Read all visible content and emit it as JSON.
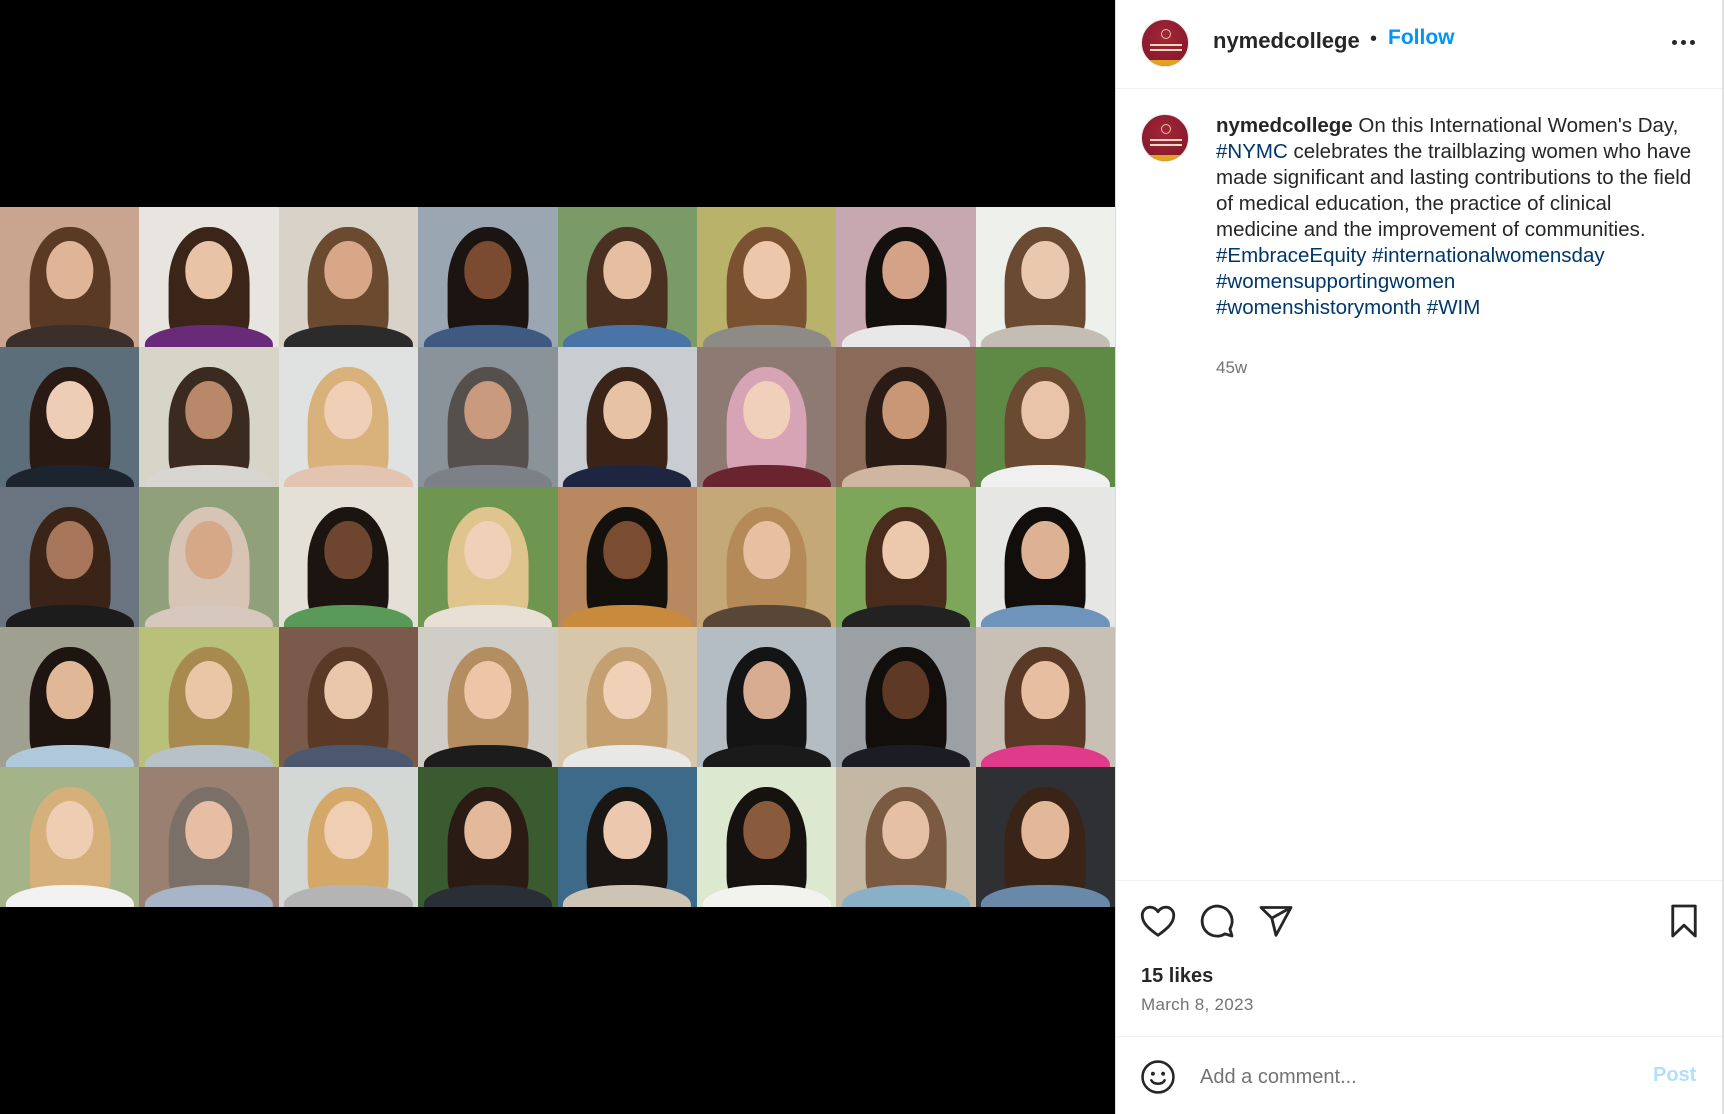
{
  "post": {
    "username": "nymedcollege",
    "separator": "•",
    "follow_label": "Follow",
    "caption": {
      "username": "nymedcollege",
      "text_1": "On this International Women's Day,",
      "tag_1": "#NYMC",
      "text_2": "celebrates the trailblazing women who have made significant and lasting contributions to the field of medical education, the practice of clinical medicine and the improvement of communities.",
      "hashtags": [
        "#EmbraceEquity",
        "#internationalwomensday",
        "#womensupportingwomen",
        "#womenshistorymonth",
        "#WIM"
      ]
    },
    "time_ago": "45w",
    "likes": "15 likes",
    "date": "March 8, 2023"
  },
  "comment": {
    "placeholder": "Add a comment...",
    "post_label": "Post"
  },
  "icons": {
    "more": "more-options-icon",
    "like": "heart-icon",
    "comment": "comment-bubble-icon",
    "share": "paper-plane-icon",
    "save": "bookmark-icon",
    "emoji": "emoji-icon"
  },
  "colors": {
    "link": "#0095f6",
    "hashtag": "#00376b",
    "brand_maroon": "#8a1a2c",
    "post_disabled": "#b2dffc"
  },
  "portrait_grid": {
    "columns": 8,
    "rows": 5,
    "tiles": [
      {
        "bg": "#c9a58f",
        "hair": "#5a3a24",
        "skin": "#e0b497",
        "shirt": "#3a2f2a"
      },
      {
        "bg": "#e8e4df",
        "hair": "#3b2418",
        "skin": "#e9c3a6",
        "shirt": "#6a2a7a"
      },
      {
        "bg": "#d9d2c9",
        "hair": "#6b4a30",
        "skin": "#d7a787",
        "shirt": "#2b2b2b"
      },
      {
        "bg": "#9aa6b1",
        "hair": "#1c1410",
        "skin": "#7a4b30",
        "shirt": "#3f5a80"
      },
      {
        "bg": "#7a9a68",
        "hair": "#4a3020",
        "skin": "#e6bfa3",
        "shirt": "#4a74a8"
      },
      {
        "bg": "#b9b26a",
        "hair": "#7a5232",
        "skin": "#ecc7ab",
        "shirt": "#8e8a85"
      },
      {
        "bg": "#c8a8b0",
        "hair": "#14100e",
        "skin": "#d3a287",
        "shirt": "#e8e8e8"
      },
      {
        "bg": "#eef0ec",
        "hair": "#6a4a30",
        "skin": "#e9c8ae",
        "shirt": "#c4bdb3"
      },
      {
        "bg": "#5b6e7a",
        "hair": "#2a1a14",
        "skin": "#edcdb6",
        "shirt": "#1c2430"
      },
      {
        "bg": "#d7d4c8",
        "hair": "#3a2a20",
        "skin": "#b9876a",
        "shirt": "#d8d6d0"
      },
      {
        "bg": "#dfe2e0",
        "hair": "#d8b27a",
        "skin": "#efcfb6",
        "shirt": "#e2c4b0"
      },
      {
        "bg": "#8a929a",
        "hair": "#55504c",
        "skin": "#c99a7e",
        "shirt": "#7e8088"
      },
      {
        "bg": "#c9ccd0",
        "hair": "#3a2418",
        "skin": "#e8c2a5",
        "shirt": "#1e2540"
      },
      {
        "bg": "#8e7a72",
        "hair": "#d6a4b4",
        "skin": "#f0d0bb",
        "shirt": "#6a2430"
      },
      {
        "bg": "#8a6a58",
        "hair": "#2a1c14",
        "skin": "#c99676",
        "shirt": "#d0b6a0"
      },
      {
        "bg": "#5e8a46",
        "hair": "#6a4a30",
        "skin": "#e9c4a8",
        "shirt": "#f0f0f0"
      },
      {
        "bg": "#6a7480",
        "hair": "#3a2418",
        "skin": "#a8765a",
        "shirt": "#1c1c1c"
      },
      {
        "bg": "#8fa07a",
        "hair": "#d8c4b4",
        "skin": "#d6a888",
        "shirt": "#d6c8bc"
      },
      {
        "bg": "#e4e0d8",
        "hair": "#1c1410",
        "skin": "#6e4630",
        "shirt": "#5a9a58"
      },
      {
        "bg": "#6e9650",
        "hair": "#e0c48e",
        "skin": "#f0d0b8",
        "shirt": "#e8e0d4"
      },
      {
        "bg": "#b88860",
        "hair": "#14100c",
        "skin": "#7a4c32",
        "shirt": "#c88a3c"
      },
      {
        "bg": "#c4a878",
        "hair": "#b48a58",
        "skin": "#e6c0a0",
        "shirt": "#5a4636"
      },
      {
        "bg": "#7ea65a",
        "hair": "#4a2c1c",
        "skin": "#ecc8ac",
        "shirt": "#222222"
      },
      {
        "bg": "#e6e6e4",
        "hair": "#120e0c",
        "skin": "#ddb294",
        "shirt": "#6e94bc"
      },
      {
        "bg": "#a0a090",
        "hair": "#1e1410",
        "skin": "#e0b898",
        "shirt": "#b0c8dc"
      },
      {
        "bg": "#b8c07a",
        "hair": "#a88a4e",
        "skin": "#ebc6a6",
        "shirt": "#b8c0c8"
      },
      {
        "bg": "#7a5a4a",
        "hair": "#5a3a26",
        "skin": "#eac6aa",
        "shirt": "#4c5870"
      },
      {
        "bg": "#d0ccc6",
        "hair": "#b48e60",
        "skin": "#ecc6a6",
        "shirt": "#1c1c1c"
      },
      {
        "bg": "#d8c6a8",
        "hair": "#c4a070",
        "skin": "#f0d0b6",
        "shirt": "#e8e8e6"
      },
      {
        "bg": "#b4bcc4",
        "hair": "#141414",
        "skin": "#d8ac90",
        "shirt": "#1a1a1a"
      },
      {
        "bg": "#9aa0a4",
        "hair": "#120e0c",
        "skin": "#5e3a26",
        "shirt": "#1c1c24"
      },
      {
        "bg": "#c8c0b4",
        "hair": "#5a3a26",
        "skin": "#e8bea0",
        "shirt": "#e03a8a"
      },
      {
        "bg": "#a4b488",
        "hair": "#d6b07a",
        "skin": "#efcdb2",
        "shirt": "#f2f2f2"
      },
      {
        "bg": "#9a8070",
        "hair": "#7a7068",
        "skin": "#e6bea4",
        "shirt": "#a8b4c8"
      },
      {
        "bg": "#d4d8d4",
        "hair": "#d4a868",
        "skin": "#f0ceb4",
        "shirt": "#b4b4b4"
      },
      {
        "bg": "#3a5a30",
        "hair": "#2a1c14",
        "skin": "#e4b89a",
        "shirt": "#2a2e36"
      },
      {
        "bg": "#3e6a8a",
        "hair": "#1a1614",
        "skin": "#ecc8ae",
        "shirt": "#cec4b6"
      },
      {
        "bg": "#dce8d0",
        "hair": "#161210",
        "skin": "#8a5a3c",
        "shirt": "#f2f2ee"
      },
      {
        "bg": "#c4b8a4",
        "hair": "#7a5a40",
        "skin": "#e6c0a4",
        "shirt": "#8ab0c8"
      },
      {
        "bg": "#2e3034",
        "hair": "#3a2418",
        "skin": "#e2b898",
        "shirt": "#6a88a8"
      }
    ]
  }
}
